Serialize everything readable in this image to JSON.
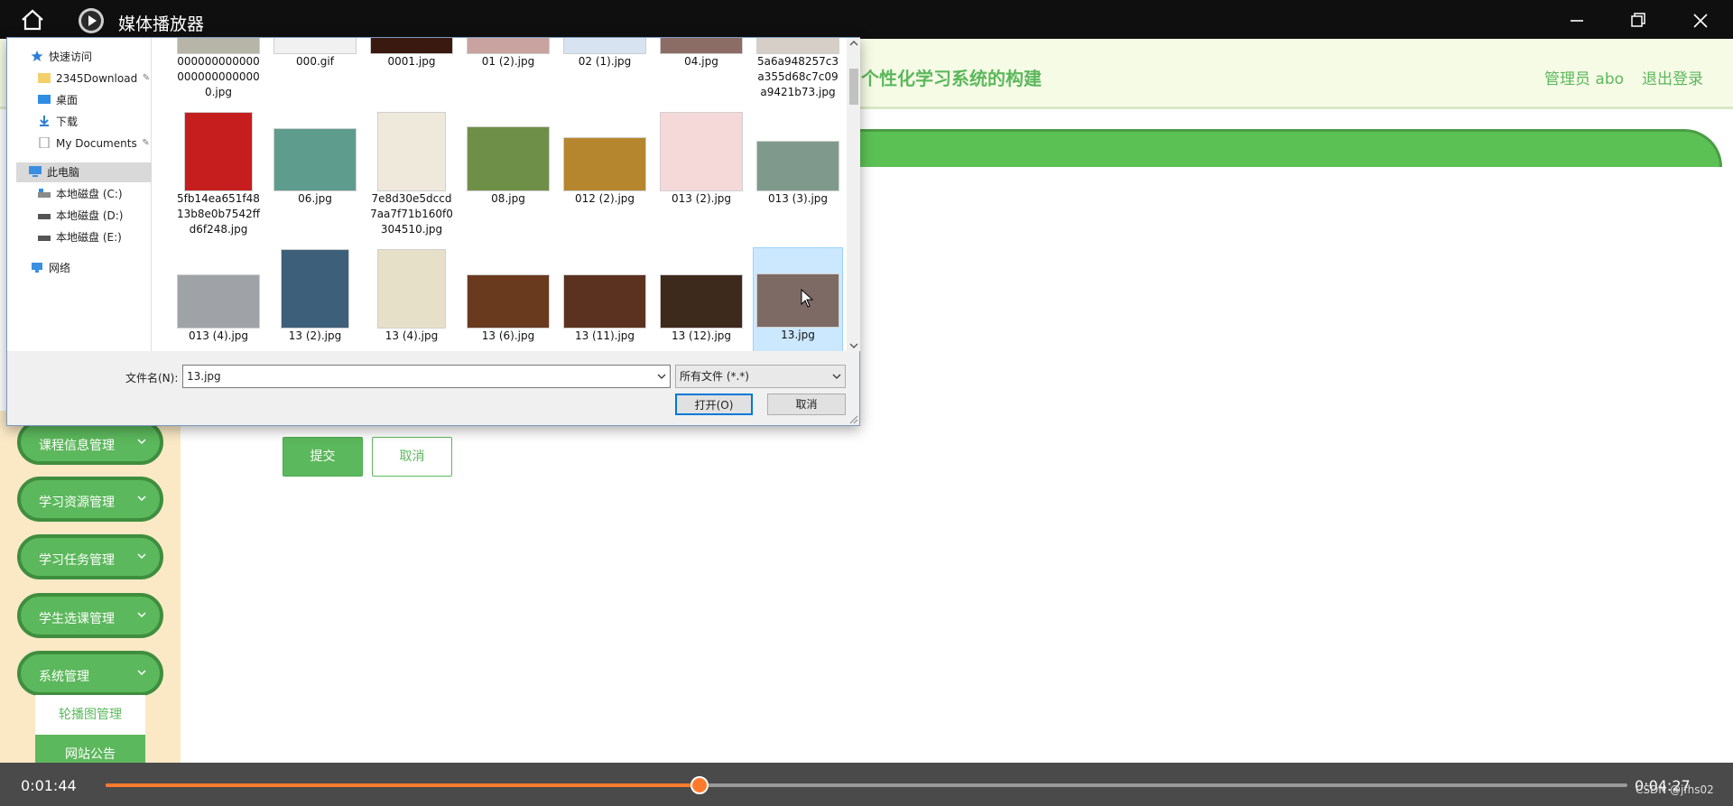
{
  "player": {
    "title": "媒体播放器",
    "time_current": "0:01:44",
    "time_total": "0:04:27",
    "progress": 0.39,
    "watermark": "CSDN @jfhs02"
  },
  "web": {
    "site_title": "个性化学习系统的构建",
    "admin": "管理员 abo",
    "logout": "退出登录",
    "menu": [
      "课程信息管理",
      "学习资源管理",
      "学习任务管理",
      "学生选课管理",
      "系统管理"
    ],
    "submenu": [
      "轮播图管理",
      "网站公告"
    ],
    "submit": "提交",
    "cancel": "取消"
  },
  "dialog": {
    "nav": {
      "quick_access": "快速访问",
      "items": [
        "2345Download",
        "桌面",
        "下载",
        "My Documents"
      ],
      "this_pc": "此电脑",
      "drives": [
        "本地磁盘 (C:)",
        "本地磁盘 (D:)",
        "本地磁盘 (E:)"
      ],
      "network": "网络"
    },
    "files": [
      [
        "0000000000000000000000000.jpg",
        "000.gif",
        "0001.jpg",
        "01 (2).jpg",
        "02 (1).jpg",
        "04.jpg",
        "5a6a948257c3a355d68c7c09a9421b73.jpg"
      ],
      [
        "5fb14ea651f4813b8e0b7542ffd6f248.jpg",
        "06.jpg",
        "7e8d30e5dccd7aa7f71b160f0304510.jpg",
        "08.jpg",
        "012 (2).jpg",
        "013 (2).jpg",
        "013 (3).jpg"
      ],
      [
        "013 (4).jpg",
        "13 (2).jpg",
        "13 (4).jpg",
        "13 (6).jpg",
        "13 (11).jpg",
        "13 (12).jpg",
        "13.jpg"
      ]
    ],
    "filename_label": "文件名(N):",
    "filename_value": "13.jpg",
    "filter_value": "所有文件 (*.*)",
    "open": "打开(O)",
    "cancel": "取消"
  },
  "colors": {
    "accent_green": "#5cb85c",
    "progress_orange": "#ff7a2b",
    "selection": "#cce8ff"
  }
}
